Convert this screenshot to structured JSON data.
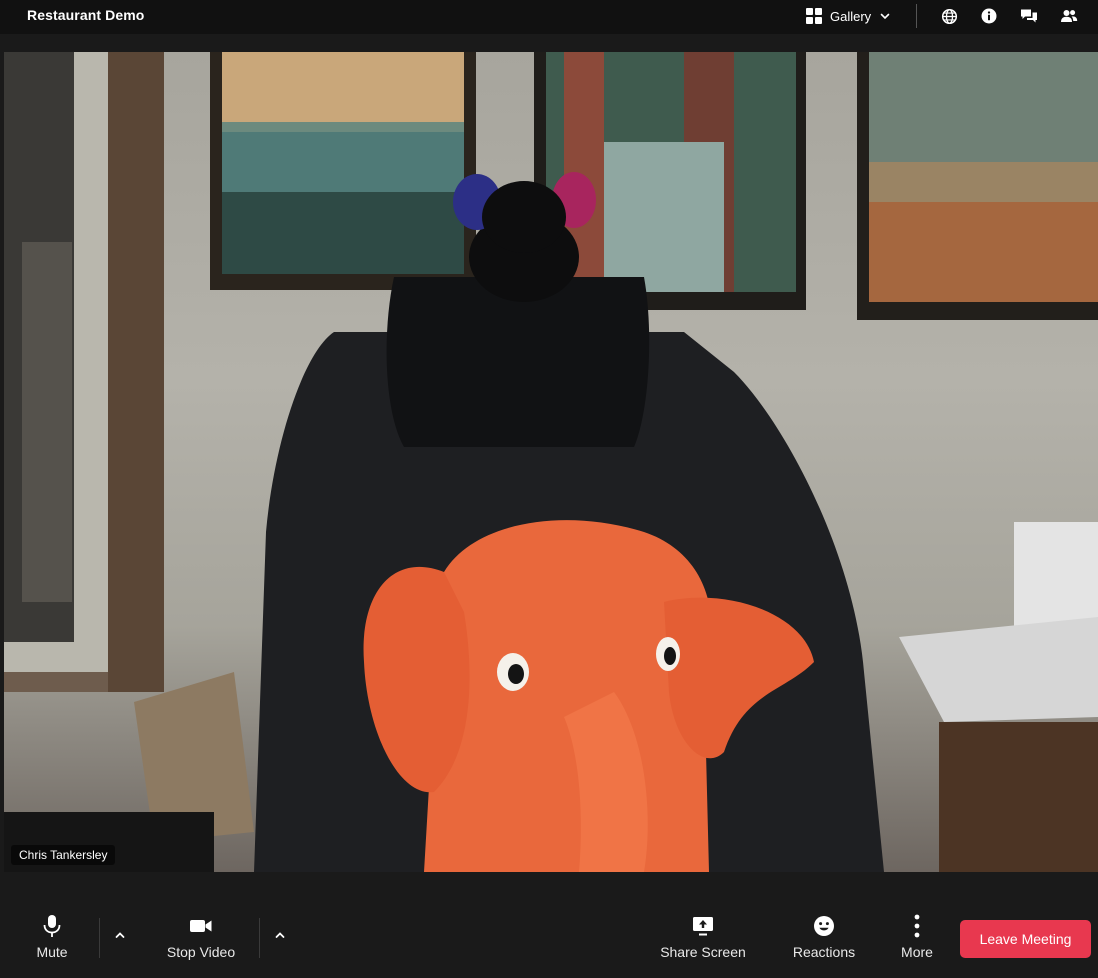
{
  "header": {
    "meeting_title": "Restaurant Demo",
    "view_label": "Gallery",
    "icons": [
      "gallery-grid-icon",
      "chevron-down-icon",
      "globe-icon",
      "info-icon",
      "chat-icon",
      "participants-icon"
    ]
  },
  "video": {
    "participant_name": "Chris Tankersley"
  },
  "toolbar": {
    "mute_label": "Mute",
    "stop_video_label": "Stop Video",
    "share_screen_label": "Share Screen",
    "reactions_label": "Reactions",
    "more_label": "More",
    "leave_label": "Leave Meeting"
  },
  "colors": {
    "leave_button": "#e8384f",
    "background": "#1a1a1a"
  }
}
